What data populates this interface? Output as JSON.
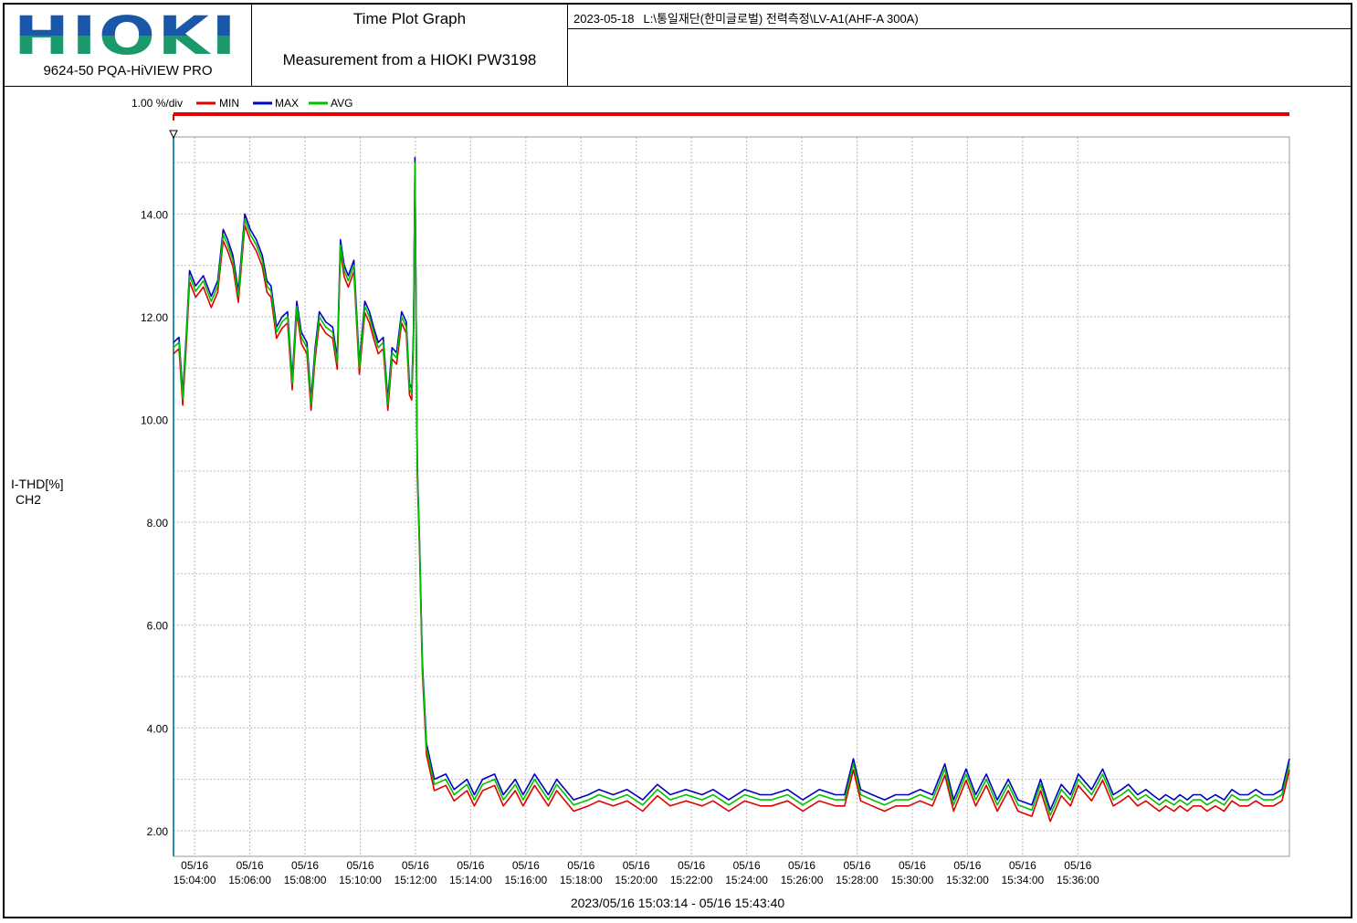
{
  "header": {
    "logo_text": "HIOKI",
    "product": "9624-50 PQA-HiVIEW PRO",
    "title": "Time Plot Graph",
    "subtitle": "Measurement from a HIOKI PW3198",
    "date": "2023-05-18",
    "path": "L:\\통일재단(한미글로벌) 전력측정\\LV-A1(AHF-A 300A)"
  },
  "colors": {
    "min": "#e00000",
    "max": "#0000c0",
    "avg": "#00c000",
    "bar": "#e00000",
    "cursor": "#2a8fa8",
    "grid": "#bbbbbb"
  },
  "chart_data": {
    "type": "line",
    "scale_label": "1.00 %/div",
    "ylabel": "I-THD[%]",
    "ylabel2": "CH2",
    "ylim": [
      1.5,
      15.5
    ],
    "yticks": [
      2.0,
      4.0,
      6.0,
      8.0,
      10.0,
      12.0,
      14.0
    ],
    "ytick_labels": [
      "2.00",
      "4.00",
      "6.00",
      "8.00",
      "10.00",
      "12.00",
      "14.00"
    ],
    "x_start": "15:03:14",
    "x_end": "15:43:40",
    "xtick_dates": [
      "05/16",
      "05/16",
      "05/16",
      "05/16",
      "05/16",
      "05/16",
      "05/16",
      "05/16",
      "05/16",
      "05/16",
      "05/16",
      "05/16",
      "05/16",
      "05/16",
      "05/16",
      "05/16",
      "05/16"
    ],
    "xtick_times": [
      "15:04:00",
      "15:06:00",
      "15:08:00",
      "15:10:00",
      "15:12:00",
      "15:14:00",
      "15:16:00",
      "15:18:00",
      "15:20:00",
      "15:22:00",
      "15:24:00",
      "15:26:00",
      "15:28:00",
      "15:30:00",
      "15:32:00",
      "15:34:00",
      "15:36:00"
    ],
    "range_label": "2023/05/16 15:03:14 - 05/16 15:43:40",
    "series": [
      {
        "name": "MIN",
        "offset": -0.12
      },
      {
        "name": "MAX",
        "offset": 0.1
      },
      {
        "name": "AVG",
        "offset": 0.0
      }
    ],
    "x": [
      "15:03:14",
      "15:03:26",
      "15:03:34",
      "15:03:42",
      "15:03:49",
      "15:04:02",
      "15:04:19",
      "15:04:36",
      "15:04:50",
      "15:05:02",
      "15:05:12",
      "15:05:23",
      "15:05:35",
      "15:05:49",
      "15:06:01",
      "15:06:14",
      "15:06:27",
      "15:06:37",
      "15:06:46",
      "15:06:58",
      "15:07:10",
      "15:07:22",
      "15:07:32",
      "15:07:42",
      "15:07:52",
      "15:08:04",
      "15:08:13",
      "15:08:22",
      "15:08:31",
      "15:08:45",
      "15:09:00",
      "15:09:10",
      "15:09:17",
      "15:09:25",
      "15:09:34",
      "15:09:46",
      "15:09:58",
      "15:10:10",
      "15:10:20",
      "15:10:29",
      "15:10:39",
      "15:10:50",
      "15:11:00",
      "15:11:09",
      "15:11:19",
      "15:11:30",
      "15:11:40",
      "15:11:47",
      "15:11:52",
      "15:11:56",
      "15:11:59",
      "15:12:04",
      "15:12:09",
      "15:12:15",
      "15:12:24",
      "15:12:41",
      "15:13:06",
      "15:13:24",
      "15:13:52",
      "15:14:08",
      "15:14:26",
      "15:14:52",
      "15:15:11",
      "15:15:37",
      "15:15:54",
      "15:16:19",
      "15:16:49",
      "15:17:07",
      "15:17:44",
      "15:18:16",
      "15:18:39",
      "15:19:10",
      "15:19:40",
      "15:20:14",
      "15:20:46",
      "15:21:14",
      "15:21:48",
      "15:22:23",
      "15:22:47",
      "15:23:21",
      "15:23:56",
      "15:24:30",
      "15:24:54",
      "15:25:29",
      "15:26:02",
      "15:26:38",
      "15:27:13",
      "15:27:33",
      "15:27:52",
      "15:28:08",
      "15:28:33",
      "15:29:00",
      "15:29:24",
      "15:29:52",
      "15:30:17",
      "15:30:44",
      "15:31:11",
      "15:31:30",
      "15:31:57",
      "15:32:18",
      "15:32:41",
      "15:33:05",
      "15:33:29",
      "15:33:50",
      "15:34:20",
      "15:34:39",
      "15:35:00",
      "15:35:24",
      "15:35:44",
      "15:36:01",
      "15:36:30",
      "15:36:54",
      "15:37:17",
      "15:37:35",
      "15:37:50",
      "15:38:10",
      "15:38:28",
      "15:38:42",
      "15:38:57",
      "15:39:11",
      "15:39:29",
      "15:39:42",
      "15:39:58",
      "15:40:11",
      "15:40:27",
      "15:40:41",
      "15:40:59",
      "15:41:18",
      "15:41:35",
      "15:41:52",
      "15:42:10",
      "15:42:27",
      "15:42:44",
      "15:43:05",
      "15:43:24",
      "15:43:40"
    ],
    "values": [
      11.4,
      11.5,
      10.4,
      11.6,
      12.8,
      12.5,
      12.7,
      12.3,
      12.6,
      13.6,
      13.4,
      13.1,
      12.4,
      13.9,
      13.6,
      13.4,
      13.1,
      12.6,
      12.5,
      11.7,
      11.9,
      12.0,
      10.7,
      12.2,
      11.6,
      11.4,
      10.3,
      11.3,
      12.0,
      11.8,
      11.7,
      11.1,
      13.4,
      12.9,
      12.7,
      13.0,
      11.0,
      12.2,
      12.0,
      11.7,
      11.4,
      11.5,
      10.3,
      11.3,
      11.2,
      12.0,
      11.8,
      10.6,
      10.5,
      11.7,
      15.0,
      9.0,
      7.5,
      5.2,
      3.6,
      2.9,
      3.0,
      2.7,
      2.9,
      2.6,
      2.9,
      3.0,
      2.6,
      2.9,
      2.6,
      3.0,
      2.6,
      2.9,
      2.5,
      2.6,
      2.7,
      2.6,
      2.7,
      2.5,
      2.8,
      2.6,
      2.7,
      2.6,
      2.7,
      2.5,
      2.7,
      2.6,
      2.6,
      2.7,
      2.5,
      2.7,
      2.6,
      2.6,
      3.3,
      2.7,
      2.6,
      2.5,
      2.6,
      2.6,
      2.7,
      2.6,
      3.2,
      2.5,
      3.1,
      2.6,
      3.0,
      2.5,
      2.9,
      2.5,
      2.4,
      2.9,
      2.3,
      2.8,
      2.6,
      3.0,
      2.7,
      3.1,
      2.6,
      2.7,
      2.8,
      2.6,
      2.7,
      2.6,
      2.5,
      2.6,
      2.5,
      2.6,
      2.5,
      2.6,
      2.6,
      2.5,
      2.6,
      2.5,
      2.7,
      2.6,
      2.6,
      2.7,
      2.6,
      2.6,
      2.7,
      3.3
    ]
  }
}
